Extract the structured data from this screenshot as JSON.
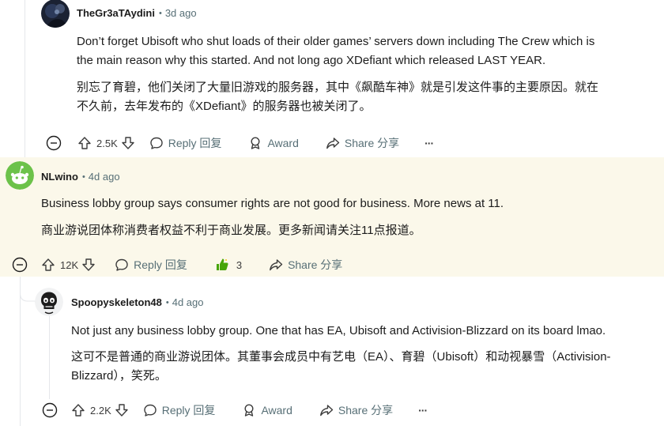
{
  "comments": [
    {
      "author": "TheGr3aTAydini",
      "time": "3d ago",
      "lines_en": [
        "Don’t forget Ubisoft who shut loads of their older games’ servers down including The Crew which is",
        "the main reason why this started. And not long ago XDefiant which released LAST YEAR."
      ],
      "lines_zh": [
        "别忘了育碧，他们关闭了大量旧游戏的服务器，其中《飙酷车神》就是引发这件事的主要原因。就在",
        "不久前，去年发布的《XDefiant》的服务器也被关闭了。"
      ],
      "votes": "2.5K",
      "reply_label": "Reply 回复",
      "award_label": "Award",
      "share_label": "Share 分享",
      "more_label": "···"
    },
    {
      "author": "NLwino",
      "time": "4d ago",
      "lines_en": [
        "Business lobby group says consumer rights are not good for business. More news at 11."
      ],
      "lines_zh": [
        "商业游说团体称消费者权益不利于商业发展。更多新闻请关注11点报道。"
      ],
      "votes": "12K",
      "reply_label": "Reply 回复",
      "award_count": "3",
      "share_label": "Share 分享",
      "more_label": "···"
    },
    {
      "author": "Spoopyskeleton48",
      "time": "4d ago",
      "lines_en": [
        "Not just any business lobby group. One that has EA, Ubisoft and Activision-Blizzard on its board lmao."
      ],
      "lines_zh": [
        "这可不是普通的商业游说团体。其董事会成员中有艺电（EA）、育碧（Ubisoft）和动视暴雪（Activision-",
        "Blizzard），笑死。"
      ],
      "votes": "2.2K",
      "reply_label": "Reply 回复",
      "award_label": "Award",
      "share_label": "Share 分享",
      "more_label": "···"
    }
  ],
  "colors": {
    "highlight_bg": "#fbf8ea",
    "meta_gray": "#576f76",
    "award_green": "#46a508",
    "avatar_green": "#6cc24a"
  },
  "icons": [
    "collapse-icon",
    "upvote-icon",
    "downvote-icon",
    "reply-icon",
    "award-icon",
    "share-icon",
    "thumbs-up-award-icon",
    "snoo-avatar-icon",
    "skull-avatar-icon"
  ]
}
